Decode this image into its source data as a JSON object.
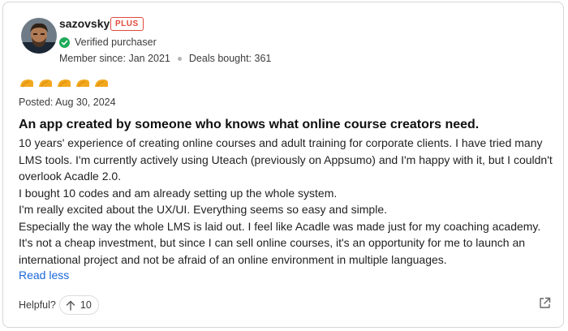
{
  "reviewer": {
    "username": "sazovsky",
    "badge": "PLUS",
    "verified_label": "Verified purchaser",
    "member_since": "Member since: Jan 2021",
    "deals_bought": "Deals bought: 361",
    "verified_color": "#1faa59",
    "badge_color": "#e2493a"
  },
  "rating": {
    "value": 5,
    "max": 5,
    "icon": "taco-icon",
    "color": "#f2a81d"
  },
  "posted": "Posted: Aug 30, 2024",
  "review": {
    "title": "An app created by someone who knows what online course creators need.",
    "paragraphs": [
      "10 years' experience of creating online courses and adult training for corporate clients. I have tried many LMS tools. I'm currently actively using Uteach (previously on Appsumo) and I'm happy with it, but I couldn't overlook Acadle 2.0.",
      "I bought 10 codes and am already setting up the whole system.",
      "I'm really excited about the UX/UI. Everything seems so easy and simple.",
      "Especially the way the whole LMS is laid out. I feel like Acadle was made just for my coaching academy.",
      "It's not a cheap investment, but since I can sell online courses, it's an opportunity for me to launch an international project and not be afraid of an online environment in multiple languages."
    ],
    "read_less_label": "Read less",
    "link_color": "#1a66d8"
  },
  "footer": {
    "helpful_label": "Helpful?",
    "upvote_count": "10",
    "share_icon": "external-link-icon"
  }
}
